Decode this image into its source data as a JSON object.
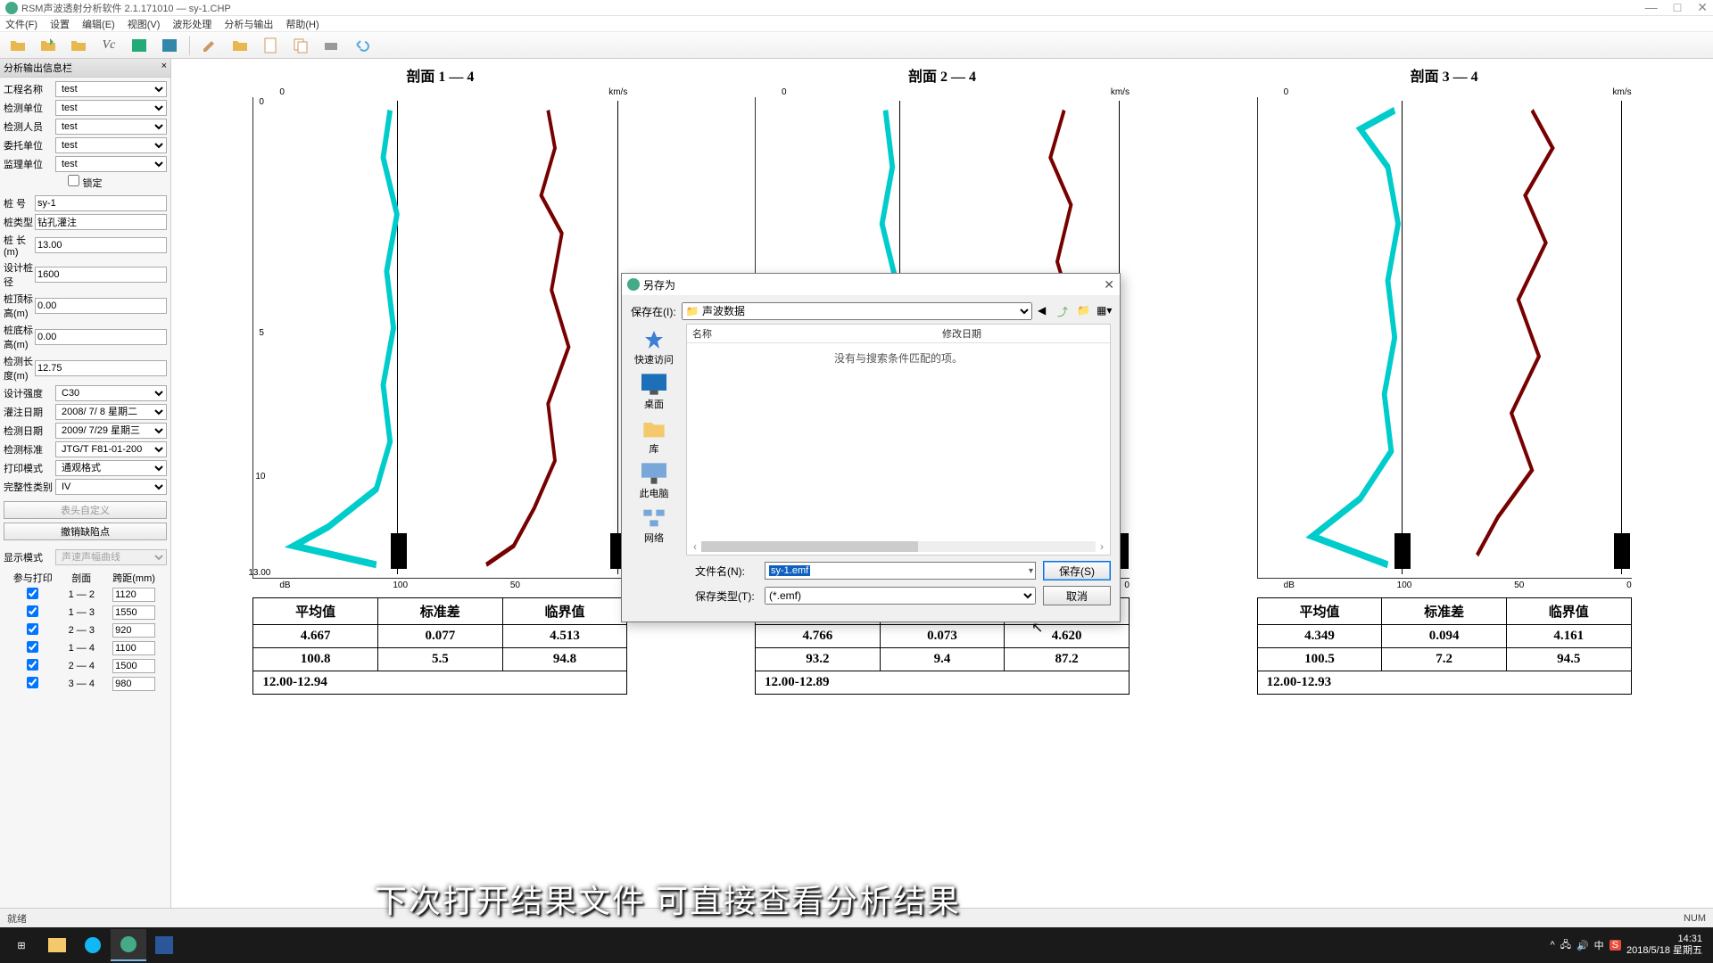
{
  "app": {
    "title": "RSM声波透射分析软件   2.1.171010   —   sy-1.CHP"
  },
  "menu": [
    "文件(F)",
    "设置",
    "编辑(E)",
    "视图(V)",
    "波形处理",
    "分析与输出",
    "帮助(H)"
  ],
  "sidebar": {
    "title": "分析输出信息栏",
    "fields": {
      "project_label": "工程名称",
      "project": "test",
      "unit_label": "检测单位",
      "unit": "test",
      "person_label": "检测人员",
      "person": "test",
      "entrust_label": "委托单位",
      "entrust": "test",
      "supervise_label": "监理单位",
      "supervise": "test",
      "lock": "锁定",
      "pile_no_label": "桩  号",
      "pile_no": "sy-1",
      "pile_type_label": "桩类型",
      "pile_type": "钻孔灌注",
      "pile_len_label": "桩  长(m)",
      "pile_len": "13.00",
      "design_d_label": "设计桩径",
      "design_d": "1600",
      "top_label": "桩顶标高(m)",
      "top": "0.00",
      "bot_label": "桩底标高(m)",
      "bot": "0.00",
      "test_len_label": "检测长度(m)",
      "test_len": "12.75",
      "design_s_label": "设计强度",
      "design_s": "C30",
      "pour_date_label": "灌注日期",
      "pour_date": "2008/ 7/ 8 星期二",
      "test_date_label": "检测日期",
      "test_date": "2009/ 7/29 星期三",
      "std_label": "检测标准",
      "std": "JTG/T F81-01-200",
      "print_mode_label": "打印模式",
      "print_mode": "通观格式",
      "integrity_label": "完整性类别",
      "integrity": "IV",
      "btn_header": "表头自定义",
      "btn_undo": "撤销缺陷点",
      "disp_mode_label": "显示模式",
      "disp_mode": "声速声幅曲线"
    },
    "print": {
      "heading_participate": "参与打印",
      "heading_section": "剖面",
      "heading_span": "跨距(mm)",
      "rows": [
        {
          "sec": "1 — 2",
          "span": "1120"
        },
        {
          "sec": "1 — 3",
          "span": "1550"
        },
        {
          "sec": "2 — 3",
          "span": "920"
        },
        {
          "sec": "1 — 4",
          "span": "1100"
        },
        {
          "sec": "2 — 4",
          "span": "1500"
        },
        {
          "sec": "3 — 4",
          "span": "980"
        }
      ]
    }
  },
  "profiles": [
    {
      "title": "剖面 1 — 4"
    },
    {
      "title": "剖面 2 — 4"
    },
    {
      "title": "剖面 3 — 4"
    }
  ],
  "axis": {
    "top_unit": "km/s",
    "bot_unit": "dB",
    "bot_ticks": [
      "",
      "",
      "100",
      "50",
      "0"
    ],
    "left_ticks": [
      "0",
      "5",
      "10",
      "13.00"
    ]
  },
  "stats": {
    "headers": [
      "平均值",
      "标准差",
      "临界值"
    ],
    "p1": {
      "mean": "4.667",
      "std": "0.077",
      "crit": "4.513",
      "m2": "100.8",
      "s2": "5.5",
      "c2": "94.8",
      "range": "12.00-12.94"
    },
    "p2": {
      "mean": "4.766",
      "std": "0.073",
      "crit": "4.620",
      "m2": "93.2",
      "s2": "9.4",
      "c2": "87.2",
      "range": "12.00-12.89"
    },
    "p3": {
      "mean": "4.349",
      "std": "0.094",
      "crit": "4.161",
      "m2": "100.5",
      "s2": "7.2",
      "c2": "94.5",
      "range": "12.00-12.93"
    }
  },
  "dialog": {
    "title": "另存为",
    "save_in": "保存在(I):",
    "folder": "声波数据",
    "col_name": "名称",
    "col_date": "修改日期",
    "empty": "没有与搜索条件匹配的项。",
    "places": [
      "快速访问",
      "桌面",
      "库",
      "此电脑",
      "网络"
    ],
    "file_label": "文件名(N):",
    "file_value": "sy-1.emf",
    "type_label": "保存类型(T):",
    "type_value": "(*.emf)",
    "save_btn": "保存(S)",
    "cancel_btn": "取消"
  },
  "status": {
    "ready": "就绪",
    "num": "NUM"
  },
  "taskbar": {
    "time": "14:31",
    "date": "2018/5/18 星期五"
  },
  "caption": "下次打开结果文件  可直接查看分析结果",
  "chart_data": [
    {
      "type": "line",
      "title": "剖面 1 — 4",
      "y_depth_range": [
        0,
        13.0
      ],
      "x_top_unit": "km/s",
      "x_bot_unit": "dB"
    },
    {
      "type": "line",
      "title": "剖面 2 — 4",
      "y_depth_range": [
        0,
        13.0
      ],
      "x_top_unit": "km/s",
      "x_bot_unit": "dB"
    },
    {
      "type": "line",
      "title": "剖面 3 — 4",
      "y_depth_range": [
        0,
        13.0
      ],
      "x_top_unit": "km/s",
      "x_bot_unit": "dB"
    }
  ]
}
